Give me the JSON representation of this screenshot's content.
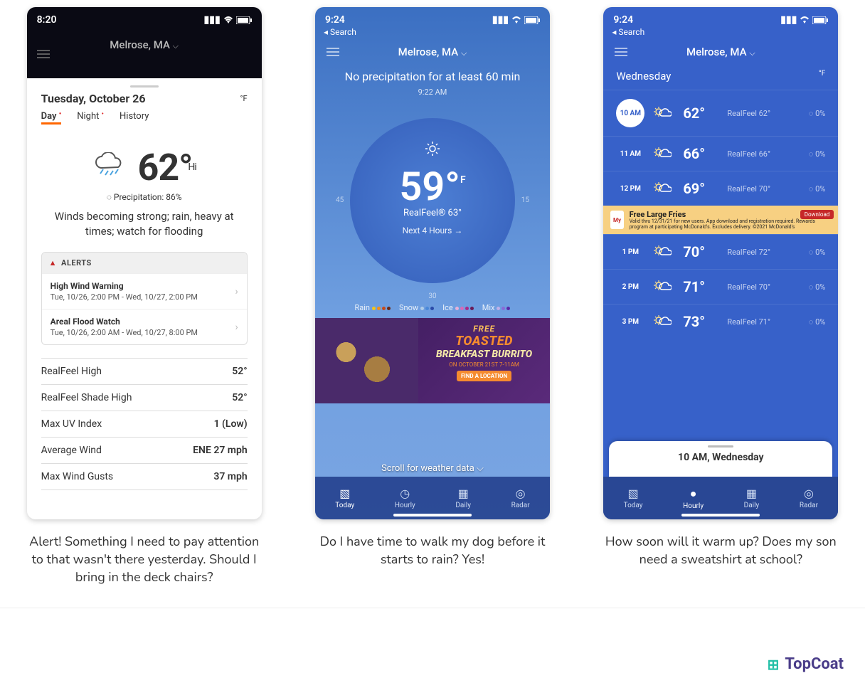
{
  "phone1": {
    "status_time": "8:20",
    "location": "Melrose, MA",
    "date": "Tuesday, October 26",
    "unit": "°F",
    "tabs": [
      "Day",
      "Night",
      "History"
    ],
    "temp": "62°",
    "temp_suffix": "Hi",
    "precip_label": "Precipitation: 86%",
    "summary": "Winds becoming strong; rain, heavy at times; watch for flooding",
    "alerts_heading": "ALERTS",
    "alerts": [
      {
        "title": "High Wind Warning",
        "sub": "Tue, 10/26, 2:00 PM - Wed, 10/27, 2:00 PM"
      },
      {
        "title": "Areal Flood Watch",
        "sub": "Tue, 10/26, 2:00 AM - Wed, 10/27, 8:00 PM"
      }
    ],
    "stats": [
      {
        "label": "RealFeel High",
        "value": "52°"
      },
      {
        "label": "RealFeel Shade High",
        "value": "52°"
      },
      {
        "label": "Max UV Index",
        "value": "1 (Low)"
      },
      {
        "label": "Average Wind",
        "value": "ENE 27 mph"
      },
      {
        "label": "Max Wind Gusts",
        "value": "37 mph"
      }
    ]
  },
  "phone2": {
    "status_time": "9:24",
    "back": "Search",
    "location": "Melrose, MA",
    "precip_line": "No precipitation for at least 60 min",
    "clock": "9:22 AM",
    "temp": "59°",
    "temp_unit": "F",
    "realfeel": "RealFeel® 63°",
    "next_hours": "Next 4 Hours →",
    "marks": {
      "left": "45",
      "right": "15",
      "bottom": "30"
    },
    "legend": [
      "Rain",
      "Snow",
      "Ice",
      "Mix"
    ],
    "ad": {
      "free": "FREE",
      "toasted": "TOASTED",
      "main": "BREAKFAST BURRITO",
      "date": "ON OCTOBER 21ST 7-11AM",
      "cta": "FIND A LOCATION"
    },
    "scroll": "Scroll for weather data",
    "nav": [
      "Today",
      "Hourly",
      "Daily",
      "Radar"
    ]
  },
  "phone3": {
    "status_time": "9:24",
    "back": "Search",
    "location": "Melrose, MA",
    "day": "Wednesday",
    "unit": "°F",
    "rows": [
      {
        "time": "10 AM",
        "temp": "62°",
        "rf": "RealFeel 62°",
        "precip": "0%"
      },
      {
        "time": "11 AM",
        "temp": "66°",
        "rf": "RealFeel 66°",
        "precip": "0%"
      },
      {
        "time": "12 PM",
        "temp": "69°",
        "rf": "RealFeel 70°",
        "precip": "0%"
      },
      {
        "time": "1 PM",
        "temp": "70°",
        "rf": "RealFeel 72°",
        "precip": "0%"
      },
      {
        "time": "2 PM",
        "temp": "71°",
        "rf": "RealFeel 70°",
        "precip": "0%"
      },
      {
        "time": "3 PM",
        "temp": "73°",
        "rf": "RealFeel 71°",
        "precip": "0%"
      }
    ],
    "ad": {
      "logo": "My",
      "title": "Free Large Fries",
      "body": "Valid thru 12/31/21 for new users. App download and registration required. Rewards program at participating McDonald's. Excludes delivery. ©2021 McDonald's",
      "cta": "Download"
    },
    "sheet": "10 AM, Wednesday",
    "nav": [
      "Today",
      "Hourly",
      "Daily",
      "Radar"
    ]
  },
  "captions": {
    "c1": "Alert! Something I need to pay attention to that wasn't there yesterday.  Should I bring in the deck chairs?",
    "c2": "Do I have time to walk my dog before it starts to rain? Yes!",
    "c3": "How soon will it warm up? Does my son need a sweatshirt at school?"
  },
  "brand": "TopCoat"
}
